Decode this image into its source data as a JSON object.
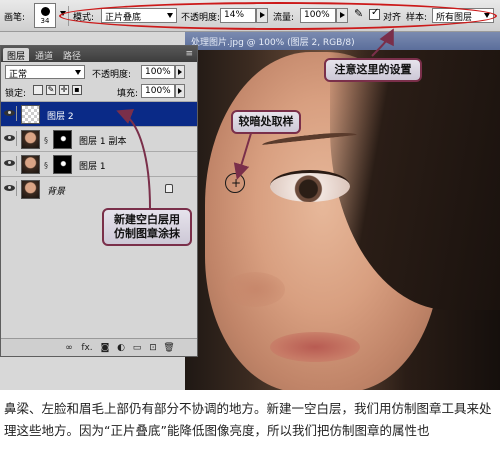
{
  "options_bar": {
    "brush_label": "画笔:",
    "brush_size": "34",
    "mode_label": "模式:",
    "mode_value": "正片叠底",
    "opacity_label": "不透明度:",
    "opacity_value": "14%",
    "flow_label": "流量:",
    "flow_value": "100%",
    "aligned_label": "对齐",
    "sample_label": "样本:",
    "sample_value": "所有图层",
    "highlight_color": "#cc1a1a"
  },
  "document": {
    "title": "处理图片.jpg @ 100% (图层 2, RGB/8)"
  },
  "layers_panel": {
    "tabs": [
      "图层",
      "通道",
      "路径"
    ],
    "blend_mode": "正常",
    "opacity_label": "不透明度:",
    "opacity_value": "100%",
    "lock_label": "锁定:",
    "fill_label": "填充:",
    "fill_value": "100%",
    "menu_glyph": "≡",
    "layers": [
      {
        "name": "图层 2",
        "selected": true
      },
      {
        "name": "图层 1 副本",
        "selected": false
      },
      {
        "name": "图层 1",
        "selected": false
      },
      {
        "name": "背景",
        "selected": false
      }
    ],
    "bottom_icons": [
      "link-icon",
      "fx-icon",
      "mask-icon",
      "adjustment-icon",
      "group-icon",
      "new-layer-icon",
      "trash-icon"
    ],
    "bottom_glyphs": [
      "∞",
      "fx.",
      "◙",
      "◐",
      "▭",
      "⊡",
      "🗑"
    ]
  },
  "callouts": {
    "settings_note": "注意这里的设置",
    "sample_note": "较暗处取样",
    "new_layer_note_line1": "新建空白层用",
    "new_layer_note_line2": "仿制图章涂抹"
  },
  "caption": {
    "text": "鼻梁、左脸和眉毛上部仍有部分不协调的地方。新建一空白层，我们用仿制图章工具来处理这些地方。因为“正片叠底”能降低图像亮度，所以我们把仿制图章的属性也"
  }
}
